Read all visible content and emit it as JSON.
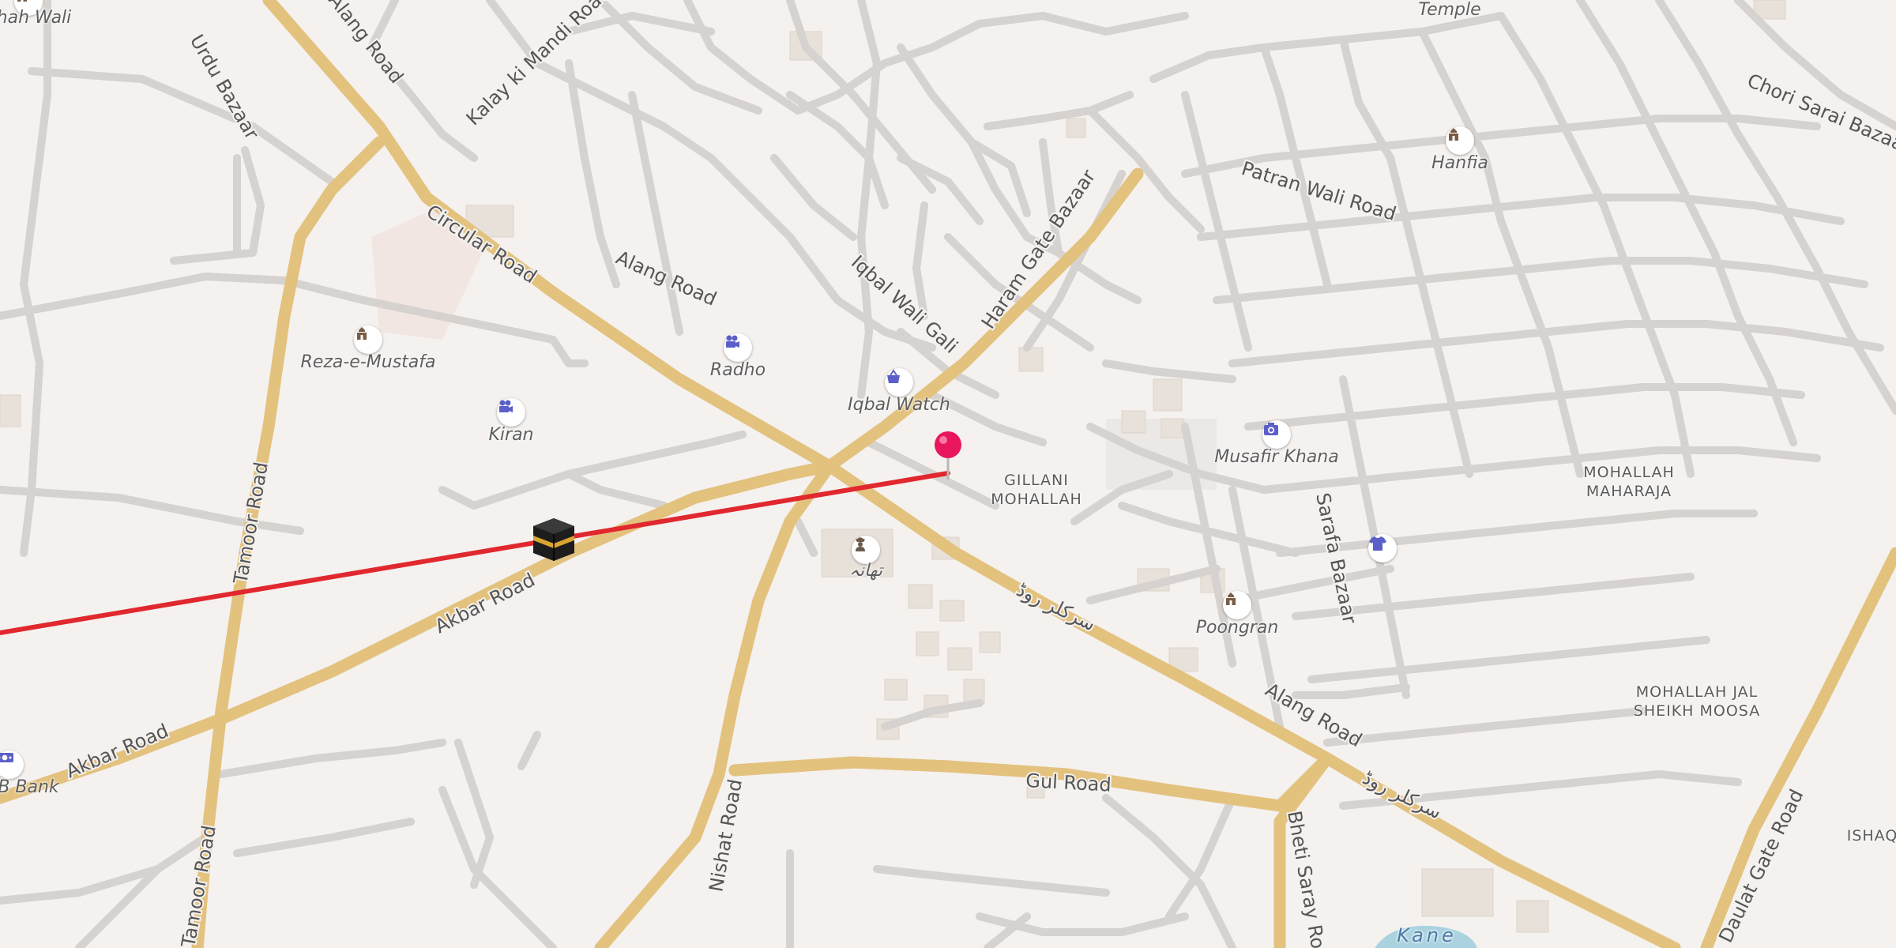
{
  "map": {
    "road_labels": {
      "alang_top": "Alang Road",
      "kalay": "Kalay ki Mandi Road",
      "urdu_bazaar": "Urdu Bazaar",
      "circular": "Circular Road",
      "alang_mid": "Alang Road",
      "iqbal_wali_gali": "Iqbal Wali Gali",
      "haram_gate": "Haram Gate Bazaar",
      "patran_wali": "Patran Wali Road",
      "chori_sarai": "Chori Sarai Bazaar",
      "tamoor_1": "Tamoor Road",
      "tamoor_2": "Tamoor Road",
      "akbar_1": "Akbar Road",
      "akbar_2": "Akbar Road",
      "circular_urdu_1": "سرکلر روڈ",
      "circular_urdu_2": "سرکلر روڈ",
      "sarafa": "Sarafa Bazaar",
      "alang_low": "Alang Road",
      "gul": "Gul Road",
      "nishat": "Nishat Road",
      "bheti_saray": "Bheti Saray Road",
      "daulat_gate": "Daulat Gate Road"
    },
    "pois": {
      "shah_wali": "Shah Wali",
      "temple": "Temple",
      "hanfia": "Hanfia",
      "reza": "Reza-e-Mustafa",
      "radho": "Radho",
      "kiran": "Kiran",
      "iqbal_watch": "Iqbal Watch",
      "musafir": "Musafir Khana",
      "thana": "تھانہ",
      "poongran": "Poongran",
      "bank": "B Bank"
    },
    "areas": {
      "gillani": "GILLANI\nMOHALLAH",
      "maharaja": "MOHALLAH\nMAHARAJA",
      "jal_sheikh": "MOHALLAH JAL\nSHEIKH MOOSA",
      "ishaq": "ISHAQ"
    },
    "water": {
      "kane": "Kane"
    },
    "icons": {
      "mosque": "mosque-icon",
      "cinema": "cinema-icon",
      "shop": "shopping-basket-icon",
      "camera": "camera-icon",
      "clothing": "shirt-icon",
      "police": "police-icon",
      "bank": "bank-icon",
      "kaaba": "kaaba-icon",
      "pin": "location-pin-icon"
    },
    "colors": {
      "background": "#f4f1ef",
      "major_road": "#fde3a0",
      "major_road_casing": "#e3c27e",
      "street": "#ffffff",
      "qibla_line": "#e0282e",
      "pin": "#e8175d",
      "poi_icon": "#5b5fc7",
      "mosque_icon": "#7a5c44"
    }
  }
}
